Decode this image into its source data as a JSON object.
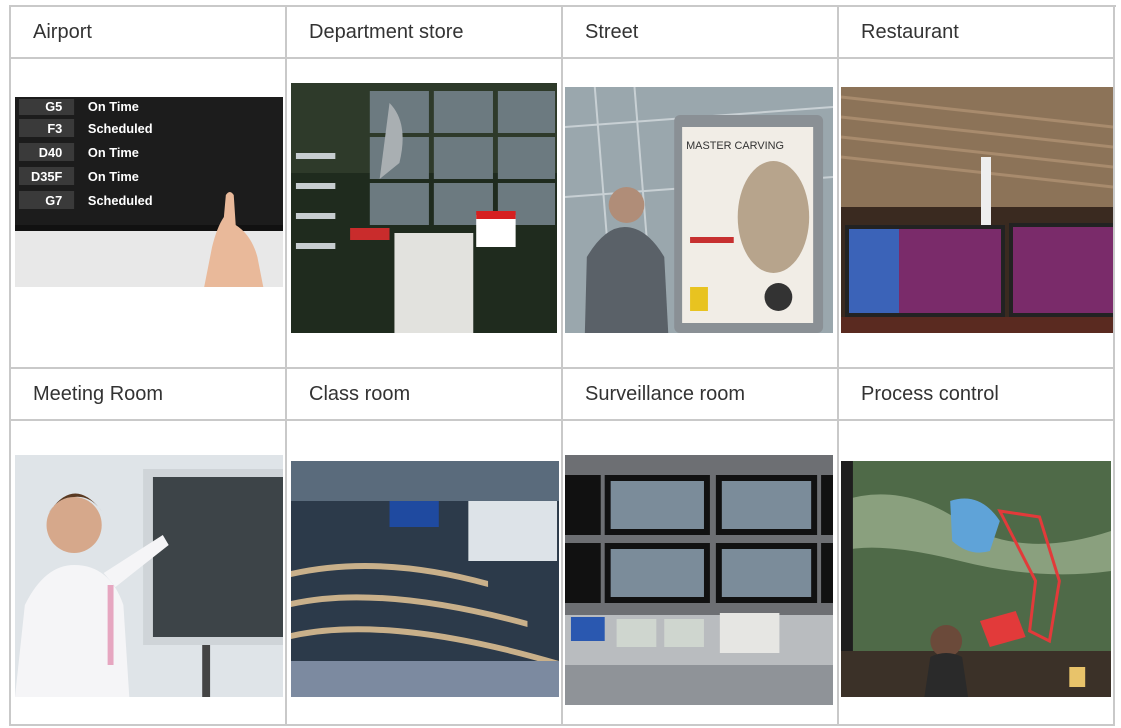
{
  "row1": {
    "headers": [
      "Airport",
      "Department store",
      "Street",
      "Restaurant"
    ]
  },
  "row2": {
    "headers": [
      "Meeting Room",
      "Class room",
      "Surveillance room",
      "Process control"
    ]
  },
  "airport_board": {
    "rows": [
      {
        "gate": "G5",
        "status": "On Time"
      },
      {
        "gate": "F3",
        "status": "Scheduled"
      },
      {
        "gate": "D40",
        "status": "On Time"
      },
      {
        "gate": "D35F",
        "status": "On Time"
      },
      {
        "gate": "G7",
        "status": "Scheduled"
      }
    ]
  },
  "street_sign": {
    "headline": "MASTER CARVING"
  }
}
